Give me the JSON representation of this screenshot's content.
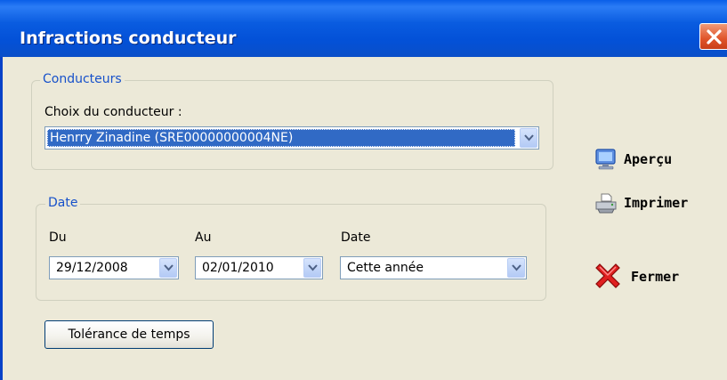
{
  "window": {
    "title": "Infractions conducteur"
  },
  "conducteurs": {
    "legend": "Conducteurs",
    "choice_label": "Choix du conducteur :",
    "selected": "Henrry Zinadine (SRE00000000004NE)"
  },
  "date_group": {
    "legend": "Date",
    "from_label": "Du",
    "from_value": "29/12/2008",
    "to_label": "Au",
    "to_value": "02/01/2010",
    "period_label": "Date",
    "period_value": "Cette année"
  },
  "buttons": {
    "tolerance": "Tolérance de temps",
    "apercu": "Aperçu",
    "imprimer": "Imprimer",
    "fermer": "Fermer"
  },
  "icons": {
    "close": "close-icon",
    "apercu": "monitor-icon",
    "imprimer": "printer-icon",
    "fermer": "red-x-icon"
  },
  "colors": {
    "titlebar": "#0A5CE0",
    "background": "#ECE9D8",
    "legend": "#1751CA",
    "selection": "#316AC5",
    "close": "#E0542A"
  }
}
